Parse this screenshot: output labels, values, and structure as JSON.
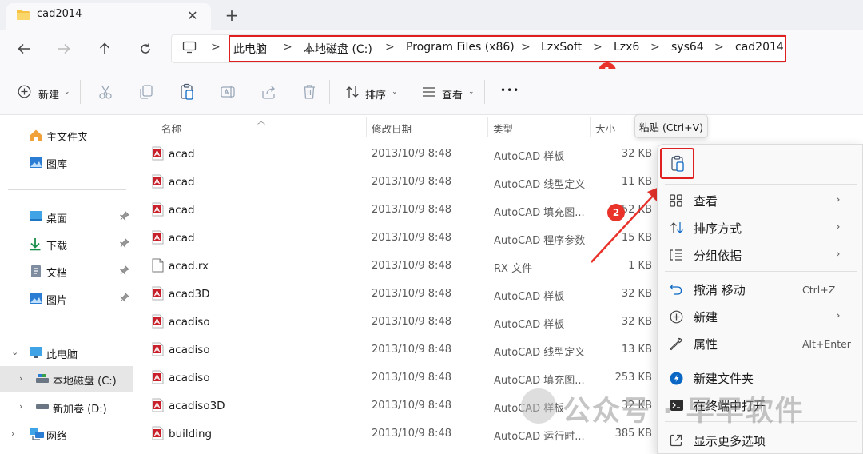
{
  "window": {
    "tab_title": "cad2014",
    "tab_close": "✕",
    "new_tab": "+"
  },
  "address": {
    "segments": [
      "此电脑",
      "本地磁盘 (C:)",
      "Program Files (x86)",
      "LzxSoft",
      "Lzx6",
      "sys64",
      "cad2014"
    ],
    "separator": ">",
    "badge": "1"
  },
  "toolbar": {
    "new_label": "新建",
    "sort_label": "排序",
    "view_label": "查看",
    "more": "•••"
  },
  "sidebar": {
    "quick": [
      {
        "label": "主文件夹",
        "icon": "home-icon"
      },
      {
        "label": "图库",
        "icon": "gallery-icon"
      }
    ],
    "pinned": [
      {
        "label": "桌面",
        "icon": "desktop-icon"
      },
      {
        "label": "下载",
        "icon": "download-icon"
      },
      {
        "label": "文档",
        "icon": "documents-icon"
      },
      {
        "label": "图片",
        "icon": "pictures-icon"
      }
    ],
    "pin_glyph": "📌",
    "tree": [
      {
        "label": "此电脑",
        "icon": "computer-icon"
      },
      {
        "label": "本地磁盘 (C:)",
        "icon": "drive-icon"
      },
      {
        "label": "新加卷 (D:)",
        "icon": "drive-icon"
      },
      {
        "label": "网络",
        "icon": "network-icon"
      }
    ]
  },
  "columns": {
    "name": "名称",
    "date": "修改日期",
    "type": "类型",
    "size": "大小"
  },
  "files": [
    {
      "name": "acad",
      "date": "2013/10/9 8:48",
      "type": "AutoCAD 样板",
      "size": "32 KB",
      "icon": "autocad-file-icon"
    },
    {
      "name": "acad",
      "date": "2013/10/9 8:48",
      "type": "AutoCAD 线型定义",
      "size": "11 KB",
      "icon": "autocad-file-icon"
    },
    {
      "name": "acad",
      "date": "2013/10/9 8:48",
      "type": "AutoCAD 填充图...",
      "size": "52 KB",
      "icon": "autocad-file-icon"
    },
    {
      "name": "acad",
      "date": "2013/10/9 8:48",
      "type": "AutoCAD 程序参数",
      "size": "15 KB",
      "icon": "autocad-file-icon"
    },
    {
      "name": "acad.rx",
      "date": "2013/10/9 8:48",
      "type": "RX 文件",
      "size": "1 KB",
      "icon": "blank-file-icon"
    },
    {
      "name": "acad3D",
      "date": "2013/10/9 8:48",
      "type": "AutoCAD 样板",
      "size": "32 KB",
      "icon": "autocad-file-icon"
    },
    {
      "name": "acadiso",
      "date": "2013/10/9 8:48",
      "type": "AutoCAD 样板",
      "size": "32 KB",
      "icon": "autocad-file-icon"
    },
    {
      "name": "acadiso",
      "date": "2013/10/9 8:48",
      "type": "AutoCAD 线型定义",
      "size": "13 KB",
      "icon": "autocad-file-icon"
    },
    {
      "name": "acadiso",
      "date": "2013/10/9 8:48",
      "type": "AutoCAD 填充图...",
      "size": "253 KB",
      "icon": "autocad-file-icon"
    },
    {
      "name": "acadiso3D",
      "date": "2013/10/9 8:48",
      "type": "AutoCAD 样板",
      "size": "32 KB",
      "icon": "autocad-file-icon"
    },
    {
      "name": "building",
      "date": "2013/10/9 8:48",
      "type": "AutoCAD 运行时...",
      "size": "385 KB",
      "icon": "autocad-file-icon"
    }
  ],
  "tooltip": "粘贴 (Ctrl+V)",
  "annotation_badge_2": "2",
  "context_menu": {
    "items": [
      {
        "label": "查看",
        "icon": "grid-icon",
        "arrow": "›"
      },
      {
        "label": "排序方式",
        "icon": "sort-icon",
        "arrow": "›"
      },
      {
        "label": "分组依据",
        "icon": "group-icon",
        "arrow": "›"
      },
      {
        "label": "撤消 移动",
        "icon": "undo-icon",
        "shortcut": "Ctrl+Z"
      },
      {
        "label": "新建",
        "icon": "new-icon",
        "arrow": "›"
      },
      {
        "label": "属性",
        "icon": "wrench-icon",
        "shortcut": "Alt+Enter"
      },
      {
        "label": "新建文件夹",
        "icon": "new-folder-icon"
      },
      {
        "label": "在终端中打开",
        "icon": "terminal-icon"
      },
      {
        "label": "显示更多选项",
        "icon": "more-options-icon"
      }
    ]
  },
  "watermark": "公众号 · 早早软件",
  "colors": {
    "annotation_red": "#e02020",
    "folder_yellow": "#f5c244",
    "autocad_red": "#c8202a",
    "accent_blue": "#0a67c4"
  }
}
